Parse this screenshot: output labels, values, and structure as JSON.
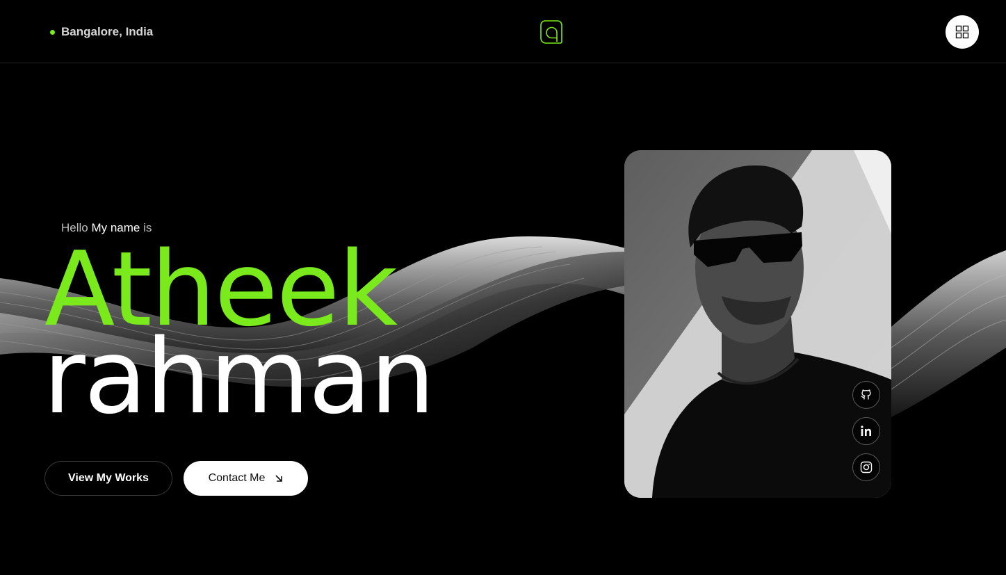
{
  "header": {
    "location": "Bangalore, India",
    "logo_icon": "a-monogram-logo",
    "menu_icon": "grid-menu-icon"
  },
  "hero": {
    "hello_prefix": "Hello ",
    "hello_highlight": "My name",
    "hello_suffix": " is",
    "first_name": "Atheek",
    "last_name": "rahman"
  },
  "buttons": {
    "works_label": "View My Works",
    "contact_label": "Contact Me",
    "contact_icon": "arrow-down-right-icon"
  },
  "social": [
    {
      "name": "github-icon"
    },
    {
      "name": "linkedin-icon"
    },
    {
      "name": "instagram-icon"
    }
  ],
  "colors": {
    "accent": "#7aea1c",
    "background": "#000000",
    "text": "#ffffff"
  }
}
